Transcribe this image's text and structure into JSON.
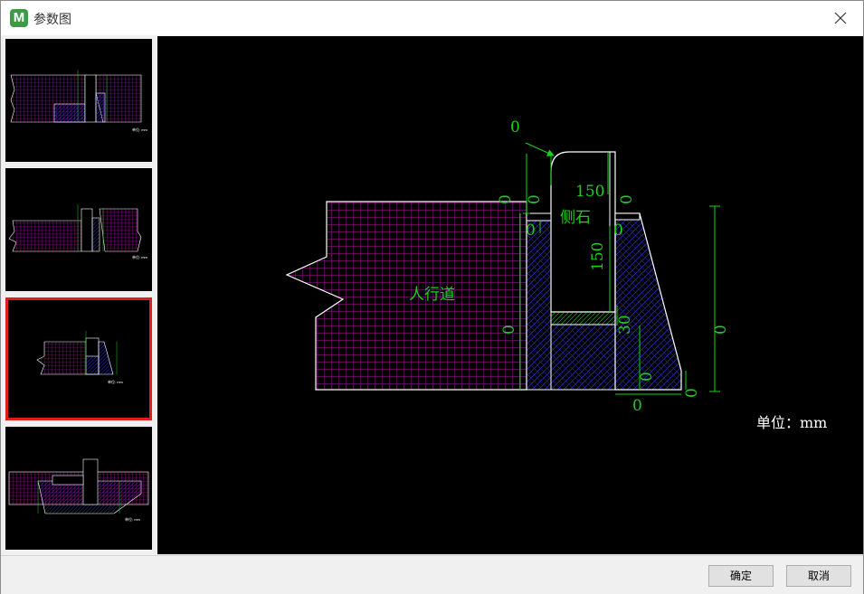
{
  "window": {
    "title": "参数图",
    "app_icon_letter": "M"
  },
  "thumbnails": [
    {
      "label": "thumbnail-1",
      "selected": false,
      "unit_text": "单位: mm"
    },
    {
      "label": "thumbnail-2",
      "selected": false,
      "unit_text": "单位: mm"
    },
    {
      "label": "thumbnail-3",
      "selected": true,
      "unit_text": "单位: mm"
    },
    {
      "label": "thumbnail-4",
      "selected": false,
      "unit_text": "单位: mm"
    }
  ],
  "drawing": {
    "sidewalk_label": "人行道",
    "curb_label": "侧石",
    "unit_label": "单位：mm",
    "dim_top_arrow": "0",
    "dim_left_upper": "0",
    "dim_curb_top_offset": "0",
    "dim_curb_width": "150",
    "dim_curb_right_upper": "0",
    "dim_curb_left_gap": "0",
    "dim_curb_height": "150",
    "dim_curb_right_gap": "0",
    "dim_left_mid": "0",
    "dim_bed_thickness": "30",
    "dim_right_overall": "0",
    "dim_base_height": "0",
    "dim_bottom_width": "0",
    "dim_right_bottom": "0"
  },
  "colors": {
    "hatch_magenta": "#a31ca3",
    "hatch_blue": "#2a2aa8",
    "dim_green": "#19d219",
    "outline": "#ffffff",
    "selection_red": "#e01c1c"
  },
  "buttons": {
    "ok_label": "确定",
    "cancel_label": "取消"
  }
}
